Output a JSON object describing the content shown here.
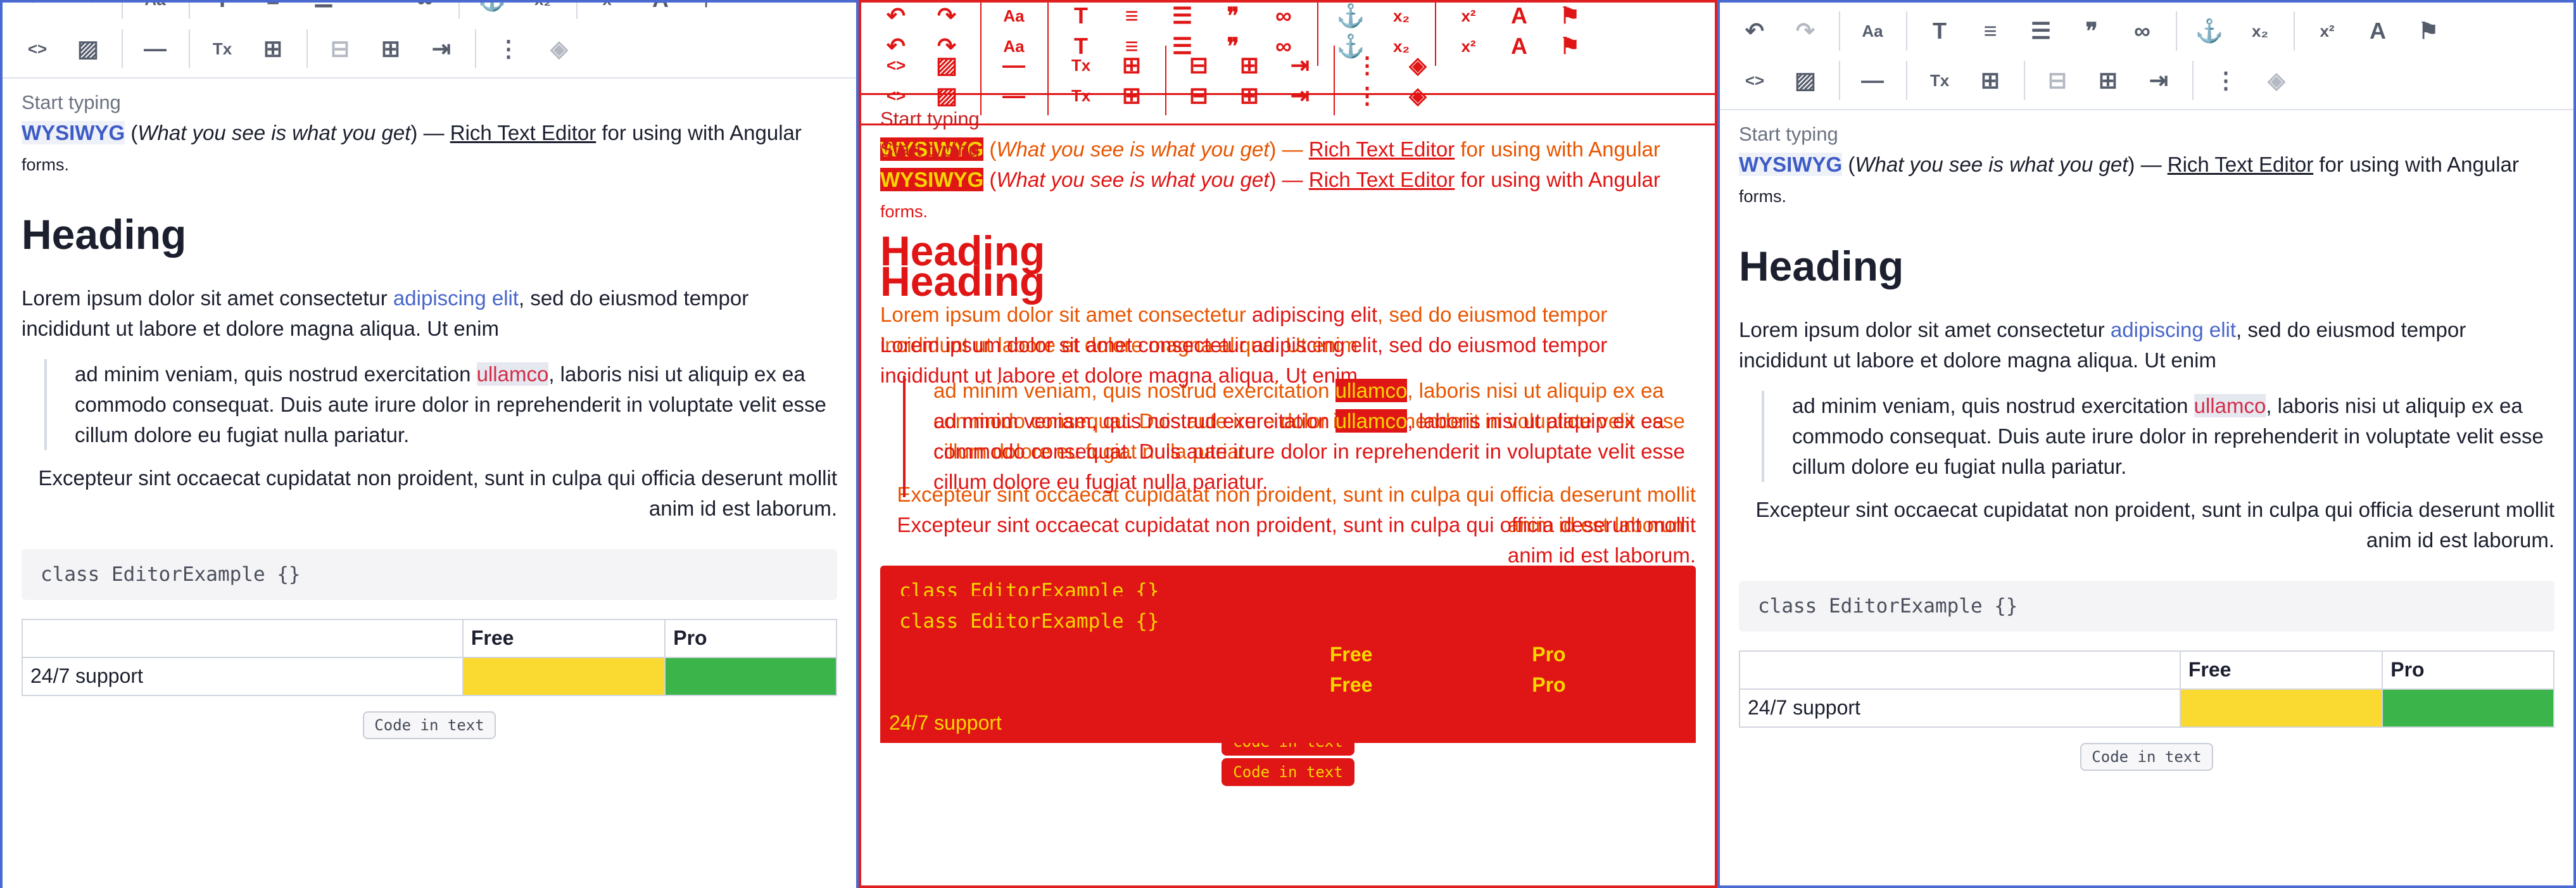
{
  "toolbar": {
    "row1": [
      {
        "name": "undo-icon",
        "glyph": "↶"
      },
      {
        "name": "redo-icon",
        "glyph": "↷"
      },
      {
        "name": "font-size-icon",
        "glyph": "Aa"
      },
      {
        "name": "text-format-icon",
        "glyph": "T"
      },
      {
        "name": "align-icon",
        "glyph": "≡"
      },
      {
        "name": "list-icon",
        "glyph": "☰"
      },
      {
        "name": "blockquote-icon",
        "glyph": "❞"
      },
      {
        "name": "link-icon",
        "glyph": "∞"
      },
      {
        "name": "anchor-icon",
        "glyph": "⚓"
      },
      {
        "name": "subscript-icon",
        "glyph": "x₂"
      },
      {
        "name": "superscript-icon",
        "glyph": "x²"
      },
      {
        "name": "text-color-icon",
        "glyph": "A"
      },
      {
        "name": "highlight-icon",
        "glyph": "⚑"
      }
    ],
    "row2": [
      {
        "name": "code-icon",
        "glyph": "<>"
      },
      {
        "name": "image-icon",
        "glyph": "▨"
      },
      {
        "name": "horizontal-rule-icon",
        "glyph": "—"
      },
      {
        "name": "clear-format-icon",
        "glyph": "Tx"
      },
      {
        "name": "insert-row-icon",
        "glyph": "⊞"
      },
      {
        "name": "remove-row-icon",
        "glyph": "⊟"
      },
      {
        "name": "table-icon",
        "glyph": "⊞"
      },
      {
        "name": "merge-cells-icon",
        "glyph": "⇥"
      },
      {
        "name": "split-cells-icon",
        "glyph": "⋮"
      },
      {
        "name": "cell-fill-icon",
        "glyph": "◈"
      }
    ]
  },
  "editor": {
    "placeholder": "Start typing",
    "intro_wysiwyg": "WYSIWYG",
    "intro_open": " (",
    "intro_italic": "What you see is what you get",
    "intro_close": ") — ",
    "intro_link": "Rich Text Editor",
    "intro_rest": " for using with Angular",
    "intro_small": "forms.",
    "heading": "Heading",
    "p_start": "Lorem ipsum dolor sit amet consectetur ",
    "p_link": "adipiscing elit",
    "p_end": ", sed do eiusmod tempor incididunt ut labore et dolore magna aliqua. Ut enim",
    "quote_start": "ad minim veniam, quis nostrud exercitation ",
    "quote_hl": "ullamco",
    "quote_end": ", laboris nisi ut aliquip ex ea commodo consequat. Duis aute irure dolor in reprehenderit in voluptate velit esse cillum dolore eu fugiat nulla pariatur.",
    "right_text": "Excepteur sint occaecat cupidatat non proident, sunt in culpa qui officia deserunt mollit anim id est laborum.",
    "code": "class EditorExample {}",
    "table": {
      "headers": [
        "",
        "Free",
        "Pro"
      ],
      "row_label": "24/7 support"
    },
    "inline_code": "Code in text"
  },
  "colors": {
    "accent": "#4866c9",
    "diff": "#e01515",
    "yellow": "#fad930",
    "green": "#3bb54a"
  }
}
